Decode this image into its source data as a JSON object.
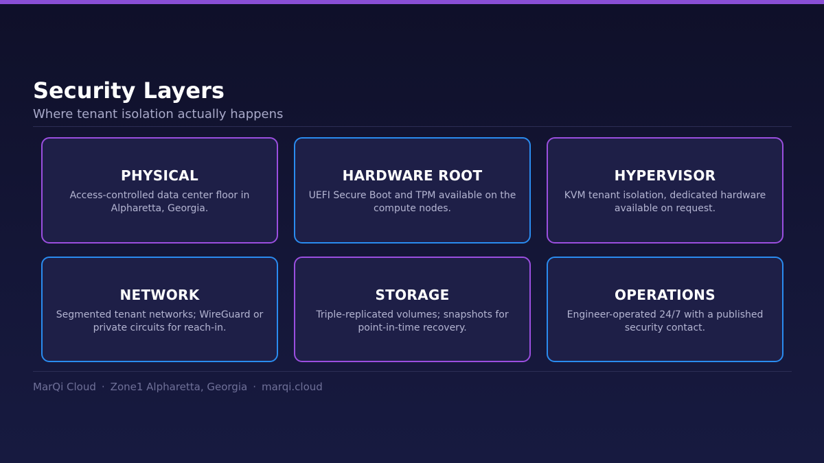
{
  "slide": {
    "title": "Security Layers",
    "subtitle": "Where tenant isolation actually happens"
  },
  "colors": {
    "accent_purple": "#9b4fe0",
    "accent_blue": "#2a8cf0",
    "background": "#141637",
    "card_background": "#1e1f47"
  },
  "cards": [
    {
      "title": "PHYSICAL",
      "text": "Access-controlled data center floor in Alpharetta, Georgia.",
      "border": "purple"
    },
    {
      "title": "HARDWARE ROOT",
      "text": "UEFI Secure Boot and TPM available on the compute nodes.",
      "border": "blue"
    },
    {
      "title": "HYPERVISOR",
      "text": "KVM tenant isolation, dedicated hardware available on request.",
      "border": "purple"
    },
    {
      "title": "NETWORK",
      "text": "Segmented tenant networks; WireGuard or private circuits for reach-in.",
      "border": "blue"
    },
    {
      "title": "STORAGE",
      "text": "Triple-replicated volumes; snapshots for point-in-time recovery.",
      "border": "purple"
    },
    {
      "title": "OPERATIONS",
      "text": "Engineer-operated 24/7 with a published security contact.",
      "border": "blue"
    }
  ],
  "footer": {
    "brand": "MarQi Cloud",
    "location": "Zone1 Alpharetta, Georgia",
    "website": "marqi.cloud",
    "separator": "·"
  }
}
